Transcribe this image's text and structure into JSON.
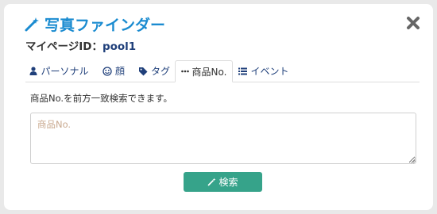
{
  "header": {
    "title": "写真ファインダー",
    "title_icon": "magic-wand-icon",
    "close_icon": "close-icon"
  },
  "mypage": {
    "label": "マイページID：",
    "user_id": "pool1"
  },
  "tabs": [
    {
      "label": "パーソナル",
      "icon": "user-icon",
      "active": false
    },
    {
      "label": "顔",
      "icon": "smile-icon",
      "active": false
    },
    {
      "label": "タグ",
      "icon": "tag-icon",
      "active": false
    },
    {
      "label": "商品No.",
      "icon": "ellipsis-icon",
      "active": true
    },
    {
      "label": "イベント",
      "icon": "list-icon",
      "active": false
    }
  ],
  "panel": {
    "description": "商品No.を前方一致検索できます。",
    "input_value": "",
    "input_placeholder": "商品No.",
    "search_label": "検索",
    "search_icon": "magic-wand-icon"
  },
  "colors": {
    "title": "#1a8bd0",
    "link": "#1f3f7a",
    "button": "#36a38a",
    "placeholder": "#c9a98f"
  }
}
